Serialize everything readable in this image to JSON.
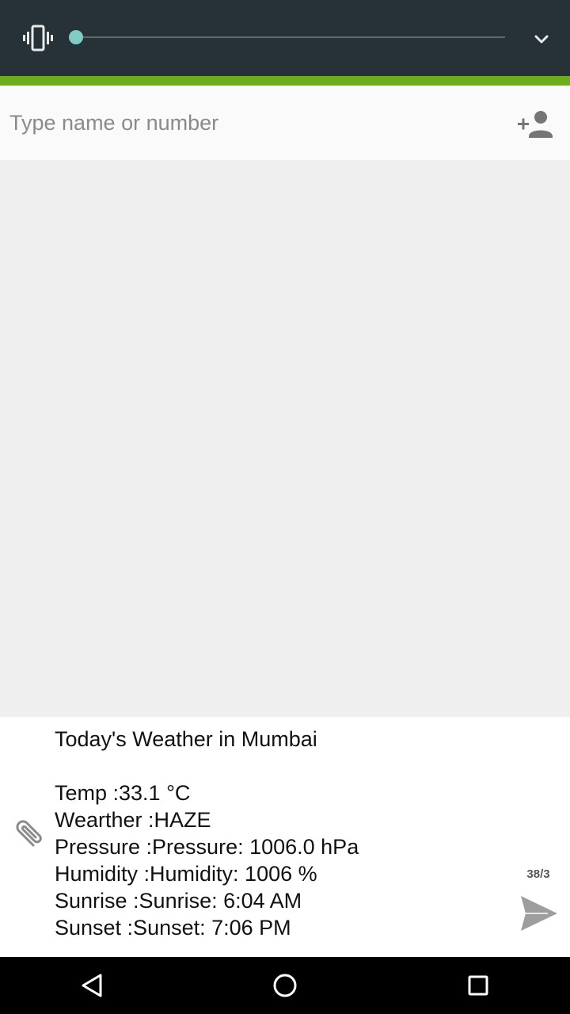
{
  "volume_panel": {
    "level": 0,
    "icons": {
      "mode": "vibrate-icon",
      "expand": "chevron-down-icon"
    },
    "colors": {
      "background": "#263238",
      "slider_accent": "#80cbc4",
      "accent_bar": "#6fae1a"
    }
  },
  "recipient": {
    "placeholder": "Type name or number",
    "value": "",
    "icon": "add-contact-icon"
  },
  "compose": {
    "message_lines": [
      "Today's Weather in Mumbai",
      "",
      "Temp :33.1 °C",
      "Wearther :HAZE",
      "Pressure :Pressure: 1006.0 hPa",
      "Humidity :Humidity: 1006 %",
      "Sunrise :Sunrise: 6:04 AM",
      "Sunset :Sunset: 7:06 PM"
    ],
    "char_counter": "38/3",
    "icons": {
      "attach": "paperclip-icon",
      "send": "send-icon"
    }
  },
  "nav_bar": {
    "icons": [
      "back-icon",
      "home-icon",
      "recents-icon"
    ]
  }
}
